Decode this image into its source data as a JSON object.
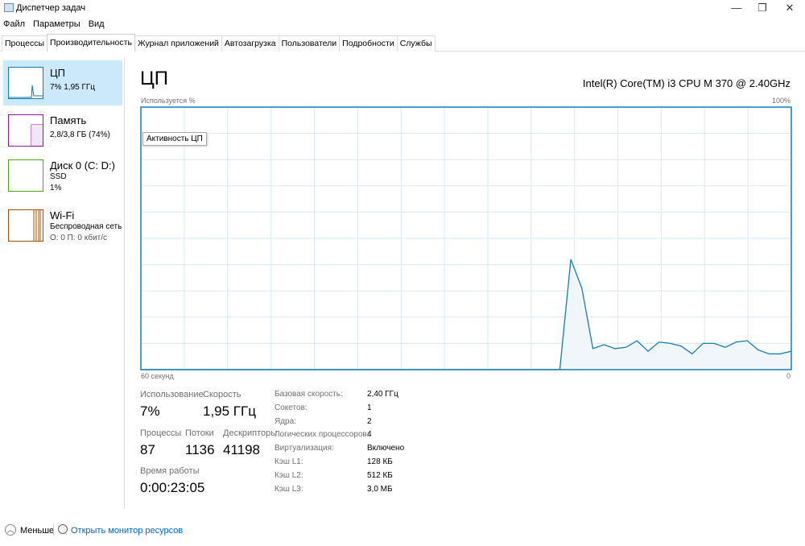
{
  "window": {
    "title": "Диспетчер задач",
    "controls": [
      "—",
      "❐",
      "✕"
    ]
  },
  "menu": [
    "Файл",
    "Параметры",
    "Вид"
  ],
  "tabs": [
    {
      "label": "Процессы"
    },
    {
      "label": "Производительность",
      "active": true
    },
    {
      "label": "Журнал приложений"
    },
    {
      "label": "Автозагрузка"
    },
    {
      "label": "Пользователи"
    },
    {
      "label": "Подробности"
    },
    {
      "label": "Службы"
    }
  ],
  "sidebar": [
    {
      "title": "ЦП",
      "sub1": "7% 1,95 ГГц",
      "color": "#117dbb"
    },
    {
      "title": "Память",
      "sub1": "2,8/3,8 ГБ (74%)",
      "color": "#8b12ae"
    },
    {
      "title": "Диск 0 (C: D:)",
      "sub1": "SSD",
      "sub2": "1%",
      "color": "#4da60c"
    },
    {
      "title": "Wi-Fi",
      "sub1": "Беспроводная сеть",
      "sub2": "О: 0 П: 0 кбит/с",
      "color": "#a74f01"
    }
  ],
  "main": {
    "title": "ЦП",
    "cpu_name": "Intel(R) Core(TM) i3 CPU M 370 @ 2.40GHz",
    "y_label": "Используется %",
    "y_max_label": "100%",
    "x_left_label": "60 секунд",
    "x_right_label": "0",
    "tooltip": "Активность ЦП"
  },
  "chart_data": {
    "type": "area",
    "title": "Активность ЦП",
    "ylabel": "Используется %",
    "xlabel": "60 секунд",
    "ylim": [
      0,
      100
    ],
    "xlim": [
      60,
      0
    ],
    "grid": true,
    "color": "#117dbb",
    "values": [
      0,
      0,
      0,
      0,
      0,
      0,
      0,
      0,
      0,
      0,
      0,
      0,
      0,
      0,
      0,
      0,
      0,
      0,
      0,
      0,
      0,
      0,
      0,
      0,
      0,
      0,
      0,
      0,
      0,
      0,
      0,
      0,
      0,
      0,
      0,
      0,
      0,
      0,
      0,
      42,
      31,
      8,
      9.5,
      8,
      8.5,
      11,
      7,
      10.5,
      10,
      9,
      6,
      10,
      10,
      8.5,
      10.5,
      11,
      7.5,
      6,
      6,
      7
    ]
  },
  "stats": {
    "usage_label": "Использование",
    "usage": "7%",
    "speed_label": "Скорость",
    "speed": "1,95 ГГц",
    "processes_label": "Процессы",
    "processes": "87",
    "threads_label": "Потоки",
    "threads": "1136",
    "handles_label": "Дескрипторы",
    "handles": "41198",
    "uptime_label": "Время работы",
    "uptime": "0:00:23:05"
  },
  "specs": [
    {
      "k": "Базовая скорость:",
      "v": "2,40 ГГц"
    },
    {
      "k": "Сокетов:",
      "v": "1"
    },
    {
      "k": "Ядра:",
      "v": "2"
    },
    {
      "k": "Логических процессоров:",
      "v": "4"
    },
    {
      "k": "Виртуализация:",
      "v": "Включено"
    },
    {
      "k": "Кэш L1:",
      "v": "128 КБ"
    },
    {
      "k": "Кэш L2:",
      "v": "512 КБ"
    },
    {
      "k": "Кэш L3:",
      "v": "3,0 МБ"
    }
  ],
  "footer": {
    "less": "Меньше",
    "monitor": "Открыть монитор ресурсов"
  }
}
